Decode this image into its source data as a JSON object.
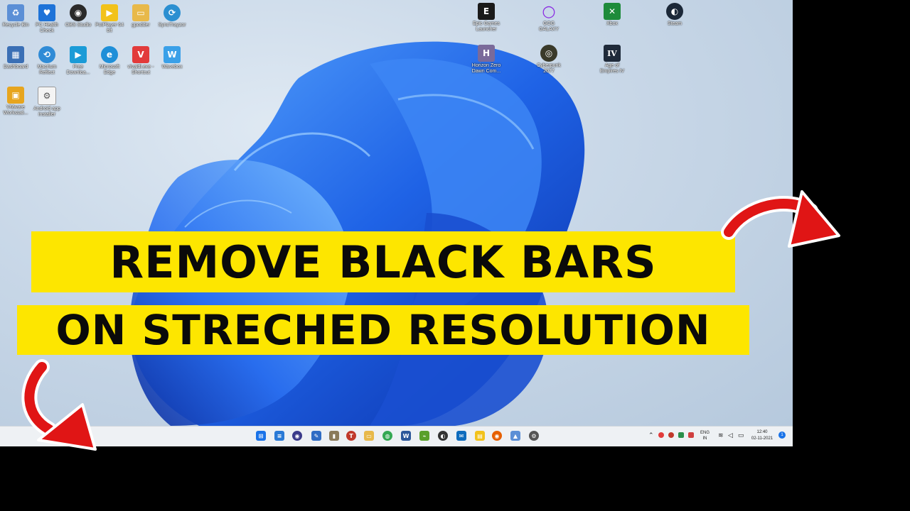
{
  "desktop_icons": [
    {
      "label": "Recycle Bin",
      "icon": "recycle-bin-icon",
      "color": "#5b8fd6",
      "glyph": "♻"
    },
    {
      "label": "PC Health Check",
      "icon": "pc-health-icon",
      "color": "#1e73d8",
      "glyph": "♥"
    },
    {
      "label": "OBS Studio",
      "icon": "obs-icon",
      "color": "#2a2a2a",
      "glyph": "◉"
    },
    {
      "label": "PotPlayer 64 bit",
      "icon": "potplayer-icon",
      "color": "#f2c21b",
      "glyph": "▶"
    },
    {
      "label": "gpodder",
      "icon": "folder-icon",
      "color": "#e8b94a",
      "glyph": "▭"
    },
    {
      "label": "SyncTrayzor",
      "icon": "sync-icon",
      "color": "#2b8fd1",
      "glyph": "⟳"
    },
    {
      "label": "Dashboard",
      "icon": "dashboard-icon",
      "color": "#3a6fb5",
      "glyph": "▦"
    },
    {
      "label": "Macrium Reflect",
      "icon": "macrium-icon",
      "color": "#2f8bd6",
      "glyph": "⟲"
    },
    {
      "label": "Free Downloa...",
      "icon": "download-icon",
      "color": "#1b9bd7",
      "glyph": "▶"
    },
    {
      "label": "Microsoft Edge",
      "icon": "edge-icon",
      "color": "#1f8fd8",
      "glyph": "e"
    },
    {
      "label": "vivaldi.exe - Shortcut",
      "icon": "vivaldi-icon",
      "color": "#e23b3b",
      "glyph": "V"
    },
    {
      "label": "Wavebox",
      "icon": "wavebox-icon",
      "color": "#3aa0e8",
      "glyph": "W"
    },
    {
      "label": "VMware Workstati...",
      "icon": "vmware-icon",
      "color": "#e7a51e",
      "glyph": "▣"
    },
    {
      "label": "Android app installer",
      "icon": "android-installer-icon",
      "color": "#f4f4f4",
      "glyph": "⚙"
    },
    {
      "label": "Epic Games Launcher",
      "icon": "epic-games-icon",
      "color": "#1a1a1a",
      "glyph": "E"
    },
    {
      "label": "GOG GALAXY",
      "icon": "gog-icon",
      "color": "#8a2be2",
      "glyph": "○"
    },
    {
      "label": "Xbox",
      "icon": "xbox-icon",
      "color": "#1e8b3a",
      "glyph": "✕"
    },
    {
      "label": "Steam",
      "icon": "steam-icon",
      "color": "#1b2838",
      "glyph": "◐"
    },
    {
      "label": "Horizon Zero Dawn Com...",
      "icon": "horizon-icon",
      "color": "#7a6a9a",
      "glyph": "H"
    },
    {
      "label": "Cyberpunk 2077",
      "icon": "cyberpunk-icon",
      "color": "#3a3a2a",
      "glyph": "◎"
    },
    {
      "label": "Age of Empires IV",
      "icon": "aoe-icon",
      "color": "#1f2a3a",
      "glyph": "IV"
    }
  ],
  "banner": {
    "line1": "REMOVE BLACK BARS",
    "line2": "ON STRECHED RESOLUTION",
    "background": "#fde600"
  },
  "taskbar": {
    "apps": [
      {
        "icon": "windows-start-icon",
        "color": "#1a73e8",
        "glyph": "⊞"
      },
      {
        "icon": "notepad-icon",
        "color": "#2a7ad6",
        "glyph": "≡"
      },
      {
        "icon": "app-lock-icon",
        "color": "#3b3b8a",
        "glyph": "◉"
      },
      {
        "icon": "pen-app-icon",
        "color": "#2f6cc4",
        "glyph": "✎"
      },
      {
        "icon": "app-box-icon",
        "color": "#8a7a5a",
        "glyph": "▮"
      },
      {
        "icon": "t-app-icon",
        "color": "#c0392b",
        "glyph": "T"
      },
      {
        "icon": "file-explorer-icon",
        "color": "#e8b94a",
        "glyph": "▭"
      },
      {
        "icon": "chrome-icon",
        "color": "#34a853",
        "glyph": "◍"
      },
      {
        "icon": "word-icon",
        "color": "#2b579a",
        "glyph": "W"
      },
      {
        "icon": "feed-icon",
        "color": "#5aa02c",
        "glyph": "⌁"
      },
      {
        "icon": "github-icon",
        "color": "#333",
        "glyph": "◐"
      },
      {
        "icon": "mail-icon",
        "color": "#0f6cbd",
        "glyph": "✉"
      },
      {
        "icon": "notes-icon",
        "color": "#f2c21b",
        "glyph": "▤"
      },
      {
        "icon": "firefox-icon",
        "color": "#e66000",
        "glyph": "◉"
      },
      {
        "icon": "photos-icon",
        "color": "#5b8fd6",
        "glyph": "▲"
      },
      {
        "icon": "settings-icon",
        "color": "#555",
        "glyph": "⚙"
      }
    ],
    "tray": {
      "lang_line1": "ENG",
      "lang_line2": "IN",
      "time": "12:40",
      "date": "02-11-2021",
      "notification_count": "1"
    }
  }
}
